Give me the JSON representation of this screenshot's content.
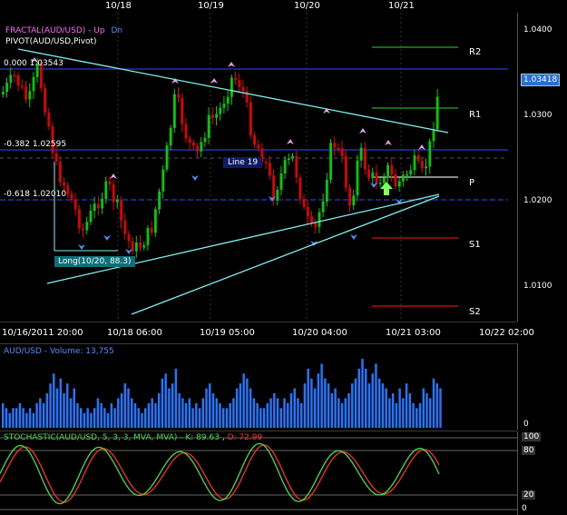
{
  "top_dates": [
    "10/18",
    "10/19",
    "10/20",
    "10/21"
  ],
  "indicators": {
    "fractal_title": "FRACTAL(AUD/USD)",
    "fractal_up": "Up",
    "fractal_dn": "Dn",
    "pivot_title": "PIVOT(AUD/USD,Pivot)"
  },
  "fib_levels": [
    {
      "label": "0.000 1.03543"
    },
    {
      "label": "-0.382 1.02595"
    },
    {
      "label": "-0.618 1.02010"
    }
  ],
  "pivot_labels": [
    "R2",
    "R1",
    "P",
    "S1",
    "S2"
  ],
  "annotations": {
    "line19": "Line 19",
    "long": "Long(10/20, 88.3)"
  },
  "price_axis": {
    "ticks": [
      "1.0400",
      "1.0300",
      "1.0200",
      "1.0100"
    ],
    "current": "1.03418"
  },
  "time_axis": [
    "10/16/2011 20:00",
    "10/18 06:00",
    "10/19 05:00",
    "10/20 04:00",
    "10/21 03:00",
    "10/22 02:00"
  ],
  "volume": {
    "title": "AUD/USD - Volume: 13,755",
    "axis_zero": "0",
    "bars": [
      5,
      4,
      3,
      4,
      4,
      5,
      4,
      3,
      4,
      3,
      5,
      6,
      5,
      7,
      9,
      11,
      8,
      10,
      7,
      9,
      6,
      8,
      5,
      4,
      3,
      4,
      3,
      4,
      6,
      5,
      4,
      3,
      5,
      4,
      6,
      7,
      9,
      8,
      6,
      5,
      4,
      3,
      4,
      5,
      6,
      5,
      7,
      10,
      11,
      8,
      9,
      12,
      7,
      6,
      5,
      6,
      4,
      5,
      4,
      6,
      8,
      9,
      7,
      6,
      5,
      4,
      4,
      5,
      6,
      8,
      9,
      11,
      10,
      8,
      6,
      5,
      4,
      4,
      5,
      6,
      7,
      6,
      4,
      6,
      5,
      7,
      8,
      6,
      5,
      9,
      12,
      10,
      8,
      11,
      13,
      10,
      9,
      7,
      8,
      6,
      5,
      6,
      7,
      9,
      10,
      12,
      14,
      12,
      9,
      11,
      13,
      10,
      9,
      8,
      6,
      7,
      5,
      8,
      6,
      9,
      7,
      5,
      4,
      5,
      8,
      7,
      6,
      10,
      9,
      8
    ]
  },
  "stochastic": {
    "title": "STOCHASTIC(AUD/USD, 5, 3, 3, MVA, MVA)",
    "k_label": "K: 89.63",
    "d_label": "D: 72.99",
    "axis_ticks": [
      "100",
      "80",
      "20",
      "0"
    ]
  },
  "colors": {
    "bull": "#00cc00",
    "bear": "#e00000",
    "trend": "#7ff0f0",
    "fib": "#2a3ad8",
    "volume": "#1f78ff",
    "stoch_k": "#44dd44",
    "stoch_d": "#ff2a2a",
    "fractal": "#e8a0e8",
    "label_pink": "#ff66ff",
    "label_blue": "#4c8dff"
  }
}
